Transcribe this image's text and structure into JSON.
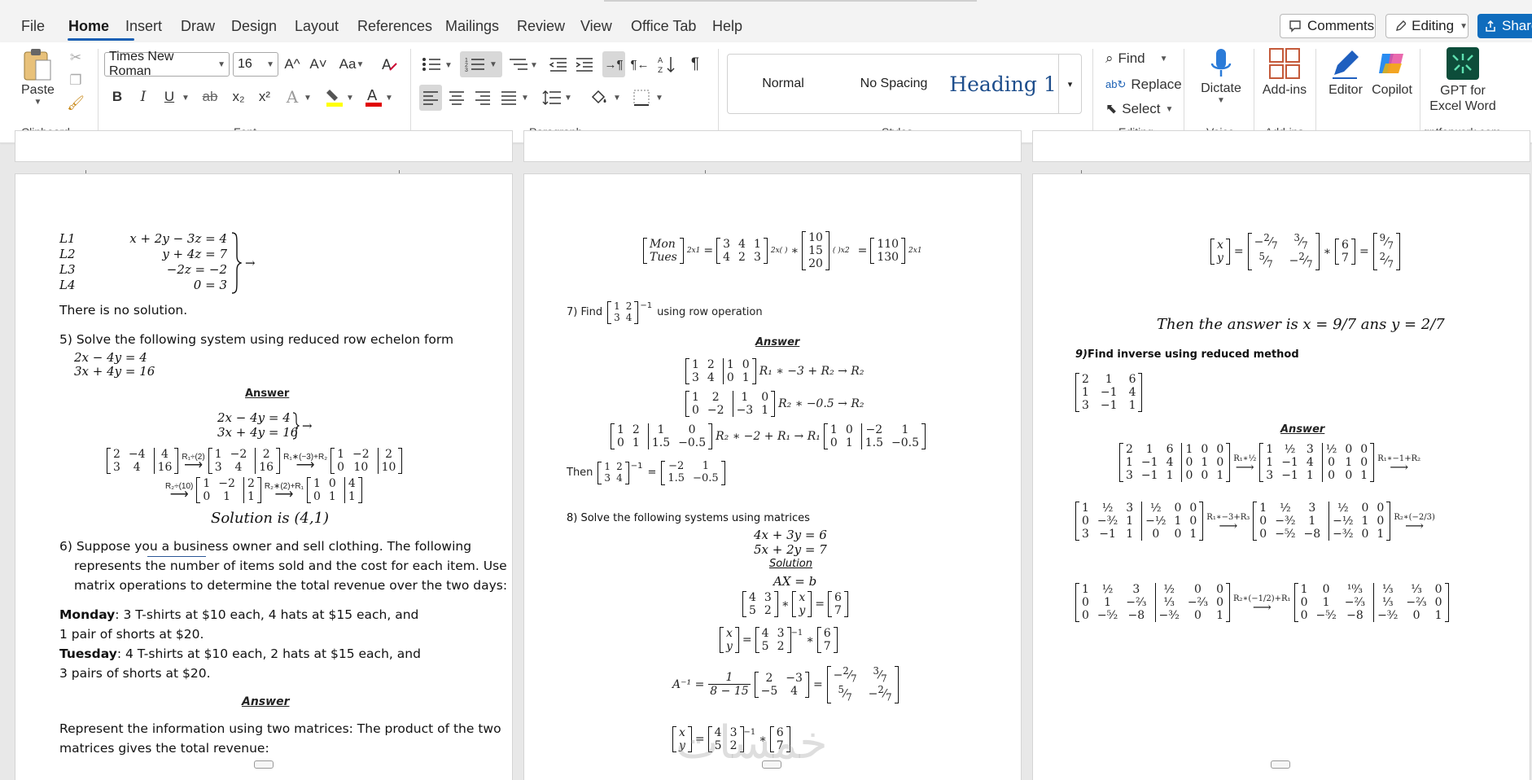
{
  "menu": {
    "items": [
      "File",
      "Home",
      "Insert",
      "Draw",
      "Design",
      "Layout",
      "References",
      "Mailings",
      "Review",
      "View",
      "Office Tab",
      "Help"
    ],
    "active": "Home",
    "comments_label": "Comments",
    "editing_label": "Editing",
    "share_label": "Share"
  },
  "ribbon": {
    "clipboard": {
      "group": "Clipboard",
      "paste": "Paste"
    },
    "font": {
      "group": "Font",
      "family": "Times New Roman",
      "size": "16",
      "grow": "A^",
      "shrink": "A˅",
      "case": "Aa",
      "bold": "B",
      "italic": "I",
      "underline": "U",
      "strike": "ab",
      "sub": "x₂",
      "sup": "x²",
      "effects": "A",
      "highlight_color": "#ffff00",
      "font_color": "#e00000"
    },
    "paragraph": {
      "group": "Paragraph"
    },
    "styles": {
      "group": "Styles",
      "normal": "Normal",
      "no_spacing": "No Spacing",
      "heading1": "Heading 1"
    },
    "editing": {
      "group": "Editing",
      "find": "Find",
      "replace": "Replace",
      "select": "Select"
    },
    "voice": {
      "group": "Voice",
      "dictate": "Dictate"
    },
    "addins": {
      "group": "Add-ins",
      "addins": "Add-ins"
    },
    "editor": "Editor",
    "copilot": "Copilot",
    "gpt": {
      "line1": "GPT for",
      "line2": "Excel Word",
      "group": "gptforwork.com"
    }
  },
  "page1": {
    "system_labels": [
      "L1",
      "L2",
      "L3",
      "L4"
    ],
    "system_eqs": [
      "x + 2y − 3z = 4",
      "y + 4z = 7",
      "−2z = −2",
      "0 = 3"
    ],
    "arrow": "→",
    "no_solution": "There is no solution.",
    "q5": "5) Solve the following system using reduced row echelon form",
    "q5_eq1": "2x − 4y    = 4",
    "q5_eq2": "3x + 4y    = 16",
    "answer": "Answer",
    "ans_eq1": "2x − 4y    = 4",
    "ans_eq2": "3x + 4y    = 16",
    "op1": "R₁÷(2)",
    "op2": "R₁∗(−3)+R₂",
    "op3": "R₂÷(10)",
    "op4": "R₂∗(2)+R₁",
    "solution": "Solution is (4,1)",
    "q6_line1": "6) Suppose you a business owner and sell clothing. The following",
    "q6_line2": "represents the number of items sold and the cost for each item. Use",
    "q6_line3": "matrix operations to determine the total revenue over the two days:",
    "monday_label": "Monday",
    "monday_text": ": 3 T-shirts at $10 each, 4 hats at $15 each, and",
    "monday_text2": "1 pair of shorts at $20.",
    "tuesday_label": "Tuesday",
    "tuesday_text": ": 4 T-shirts at $10 each, 2 hats at $15 each, and",
    "tuesday_text2": "3 pairs of shorts at $20.",
    "answer2": "Answer",
    "represent1": "Represent the information using two matrices: The product of the two",
    "represent2": "matrices gives the total revenue:"
  },
  "page2": {
    "mon": "Mon",
    "tues": "Tues",
    "q7_pre": "7)  Find",
    "q7_post": "using row operation",
    "answer": "Answer",
    "r1": "R₁ ∗ −3 + R₂ → R₂",
    "r2": "R₂ ∗ −0.5 → R₂",
    "r3": "R₂ ∗ −2 + R₁ → R₁",
    "then": "Then",
    "q8": "8)  Solve the following systems using matrices",
    "q8_eq1": "4x + 3y = 6",
    "q8_eq2": "5x + 2y = 7",
    "solution": "Solution",
    "axb": "AX = b",
    "ainv": "A⁻¹ =",
    "frac_num": "1",
    "frac_den": "8 − 15"
  },
  "page3": {
    "then_answer": "Then the answer is x = 9/7  ans y = 2/7",
    "q9_num": "9)",
    "q9_text": "Find inverse using reduced method",
    "answer": "Answer",
    "op1": "R₁∗½",
    "op2": "R₁∗−1+R₂",
    "op3": "R₁∗−3+R₃",
    "op4": "R₂∗(−2/3)",
    "op5": "R₂∗(−1/2)+R₁"
  },
  "watermark": "خمسات"
}
